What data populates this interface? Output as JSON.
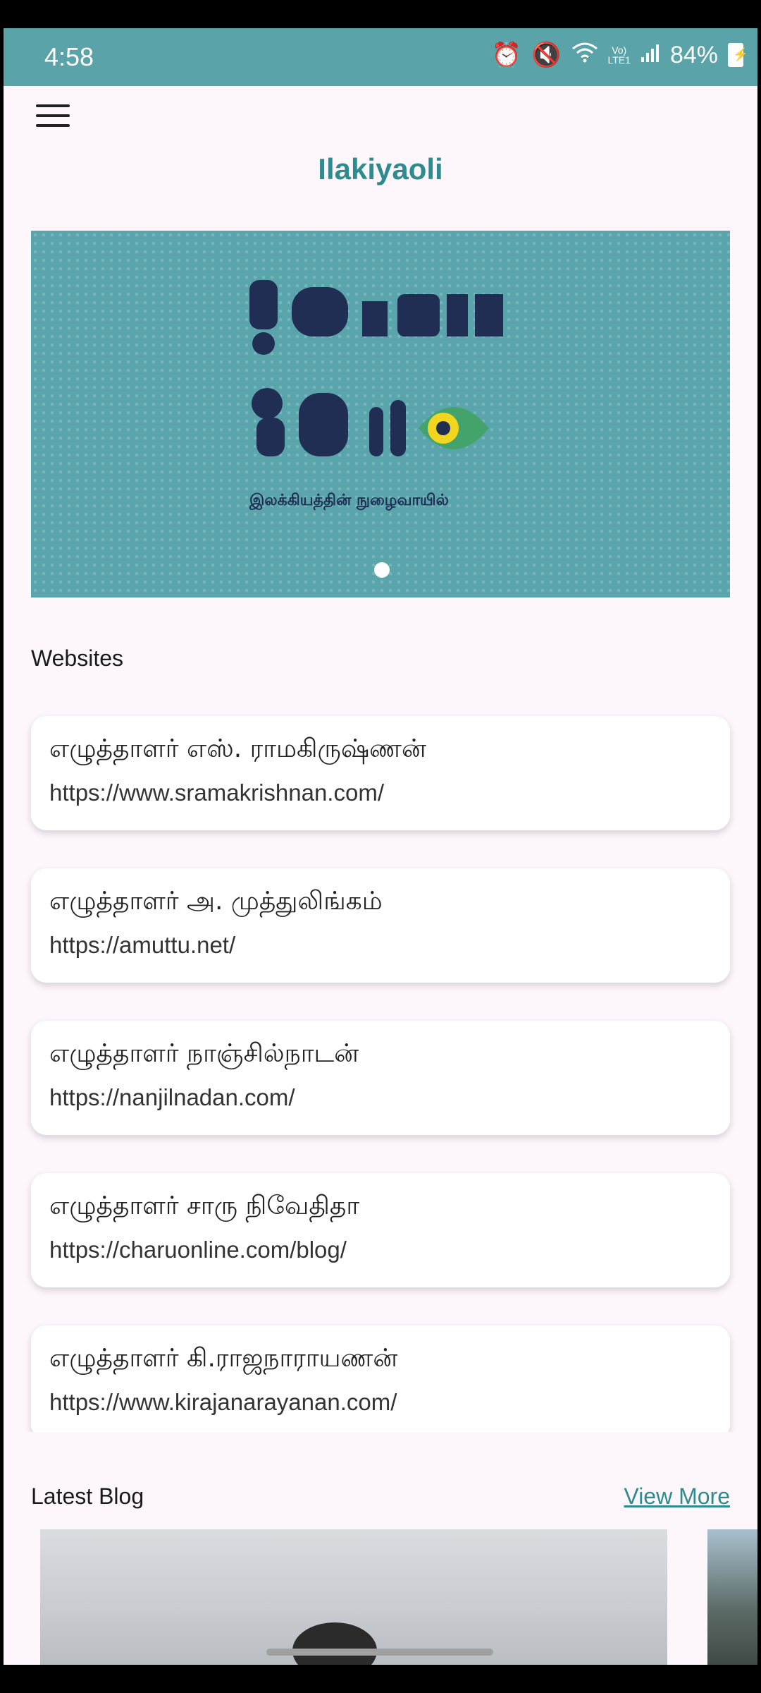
{
  "status_bar": {
    "time": "4:58",
    "battery": "84%"
  },
  "app_bar": {
    "title": "Ilakiyaoli"
  },
  "banner": {
    "caption": "இலக்கியத்தின் நுழைவாயில்"
  },
  "websites": {
    "title": "Websites",
    "items": [
      {
        "name": "எழுத்தாளர் எஸ். ராமகிருஷ்ணன்",
        "url": "https://www.sramakrishnan.com/"
      },
      {
        "name": "எழுத்தாளர் அ. முத்துலிங்கம்",
        "url": "https://amuttu.net/"
      },
      {
        "name": "எழுத்தாளர் நாஞ்சில்நாடன்",
        "url": "https://nanjilnadan.com/"
      },
      {
        "name": "எழுத்தாளர் சாரு நிவேதிதா",
        "url": "https://charuonline.com/blog/"
      },
      {
        "name": "எழுத்தாளர் கி.ராஜநாராயணன்",
        "url": "https://www.kirajanarayanan.com/"
      }
    ]
  },
  "latest_blog": {
    "title": "Latest Blog",
    "view_more": "View More"
  },
  "colors": {
    "accent": "#2e8b8f",
    "status_bar": "#5aa3a9",
    "banner_bg": "#5aa5ac",
    "logo_navy": "#1f2e52"
  }
}
